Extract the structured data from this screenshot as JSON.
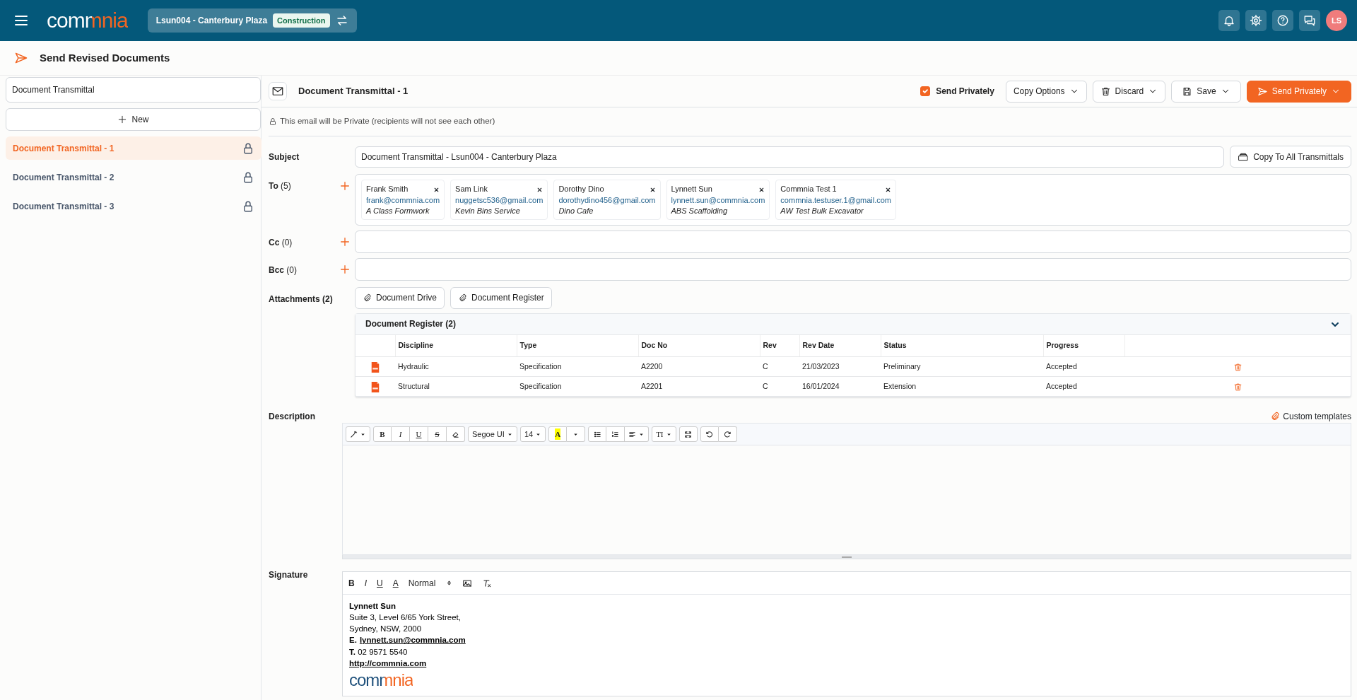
{
  "header": {
    "logo": "commnia",
    "project": "Lsun004 - Canterbury Plaza",
    "project_tag": "Construction",
    "avatar": "LS"
  },
  "page_title": "Send Revised Documents",
  "sidebar": {
    "search_value": "Document Transmittal",
    "new_button": "New",
    "items": [
      {
        "label": "Document Transmittal - 1",
        "selected": true
      },
      {
        "label": "Document Transmittal - 2",
        "selected": false
      },
      {
        "label": "Document Transmittal - 3",
        "selected": false
      }
    ]
  },
  "transmittal": {
    "title": "Document Transmittal - 1",
    "send_privately": {
      "label": "Send Privately",
      "checked": true
    },
    "buttons": [
      {
        "label": "Copy Options",
        "kind": "options"
      },
      {
        "label": "Discard",
        "kind": "discard"
      },
      {
        "label": "Save",
        "kind": "save"
      },
      {
        "label": "Send Privately",
        "kind": "send"
      }
    ],
    "private_note": "This email will be Private (recipients will not see each other)",
    "subject": {
      "label": "Subject",
      "value": "Document Transmittal - Lsun004 - Canterbury Plaza",
      "copy_button": "Copy To All Transmittals"
    },
    "to": {
      "label": "**To** (5)",
      "recipients": [
        {
          "name": "Frank Smith",
          "email": "frank@commnia.com",
          "company": "A Class Formwork"
        },
        {
          "name": "Sam Link",
          "email": "nuggetsc536@gmail.com",
          "company": "Kevin Bins Service"
        },
        {
          "name": "Dorothy Dino",
          "email": "dorothydino456@gmail.com",
          "company": "Dino Cafe"
        },
        {
          "name": "Lynnett Sun",
          "email": "lynnett.sun@commnia.com",
          "company": "ABS Scaffolding"
        },
        {
          "name": "Commnia Test 1",
          "email": "commnia.testuser.1@gmail.com",
          "company": "AW Test Bulk Excavator"
        }
      ]
    },
    "cc": {
      "label": "**Cc** (0)"
    },
    "bcc": {
      "label": "**Bcc** (0)"
    },
    "attachments": {
      "label": "Attachments (2)",
      "buttons": [
        "Document Drive",
        "Document Register"
      ],
      "register": {
        "title": "Document Register (2)",
        "expanded": true,
        "columns": [
          "Discipline",
          "Type",
          "Doc No",
          "Rev",
          "Rev Date",
          "Status",
          "Progress"
        ],
        "rows": [
          [
            "Hydraulic",
            "Specification",
            "A2200",
            "C",
            "21/03/2023",
            "Preliminary",
            "Accepted"
          ],
          [
            "Structural",
            "Specification",
            "A2201",
            "C",
            "16/01/2024",
            "Extension",
            "Accepted"
          ]
        ]
      }
    },
    "description": {
      "label": "Description",
      "custom_templates": "Custom templates",
      "toolbar": [
        [
          {
            "kind": "wand",
            "caret": true
          }
        ],
        [
          {
            "kind": "bold",
            "text": "B"
          },
          {
            "kind": "italic",
            "text": "I"
          },
          {
            "kind": "underline",
            "text": "U"
          },
          {
            "kind": "strike",
            "text": "S"
          },
          {
            "kind": "eraser"
          }
        ],
        [
          {
            "kind": "font",
            "text": "Segoe UI",
            "caret": true
          }
        ],
        [
          {
            "kind": "size",
            "text": "14",
            "caret": true
          }
        ],
        [
          {
            "kind": "highlight",
            "text": "A"
          },
          {
            "kind": "menu",
            "caret": true
          }
        ],
        [
          {
            "kind": "bullets"
          },
          {
            "kind": "numbers"
          },
          {
            "kind": "align",
            "caret": true
          }
        ],
        [
          {
            "kind": "height",
            "text": "TI",
            "caret": true
          }
        ],
        [
          {
            "kind": "fullscreen"
          }
        ],
        [
          {
            "kind": "undo"
          },
          {
            "kind": "redo"
          }
        ]
      ]
    },
    "signature": {
      "label": "Signature",
      "toolbar": [
        {
          "kind": "bold",
          "text": "B"
        },
        {
          "kind": "italic",
          "text": "I"
        },
        {
          "kind": "underline",
          "text": "U"
        },
        {
          "kind": "color",
          "text": "A"
        },
        {
          "kind": "select",
          "text": "Normal"
        },
        {
          "kind": "image"
        },
        {
          "kind": "clear"
        }
      ],
      "lines": [
        {
          "kind": "name",
          "text": "Lynnett Sun"
        },
        {
          "kind": "plain",
          "text": "Suite 3, Level 6/65 York Street,"
        },
        {
          "kind": "plain",
          "text": "Sydney, NSW, 2000"
        },
        {
          "kind": "email",
          "prefix": "E.",
          "link": "lynnett.sun@commnia.com"
        },
        {
          "kind": "plain",
          "text": "**T.** 02 9571 5540"
        },
        {
          "kind": "link",
          "link": "http://commnia.com"
        },
        {
          "kind": "logo",
          "text": "commnia"
        }
      ]
    }
  }
}
